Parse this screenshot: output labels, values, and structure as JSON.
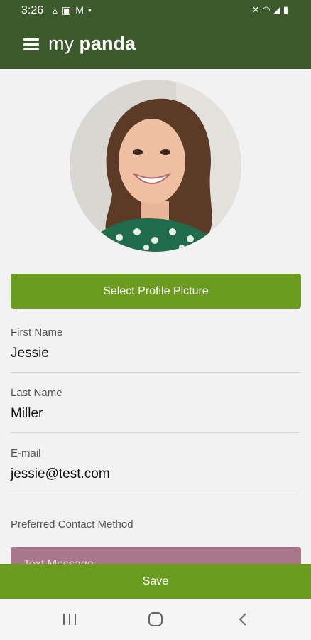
{
  "status_bar": {
    "time": "3:26",
    "left_icons": [
      "drive-icon",
      "image-icon",
      "gmail-icon",
      "dot-icon"
    ],
    "right_icons": [
      "mute-icon",
      "wifi-icon",
      "signal-icon",
      "battery-icon"
    ]
  },
  "app_bar": {
    "brand_prefix": "my ",
    "brand_bold": "panda",
    "menu_icon": "menu-icon"
  },
  "profile": {
    "select_picture_label": "Select Profile Picture"
  },
  "fields": [
    {
      "label": "First Name",
      "value": "Jessie"
    },
    {
      "label": "Last Name",
      "value": "Miller"
    },
    {
      "label": "E-mail",
      "value": "jessie@test.com"
    }
  ],
  "contact": {
    "label": "Preferred Contact Method",
    "selected": "Text Message"
  },
  "save_label": "Save",
  "nav": [
    "recents-icon",
    "home-icon",
    "back-icon"
  ],
  "colors": {
    "app_bar": "#3c5a2b",
    "primary_button": "#6b9c1f",
    "contact_select": "#a8778a",
    "background": "#f2f2f2"
  }
}
